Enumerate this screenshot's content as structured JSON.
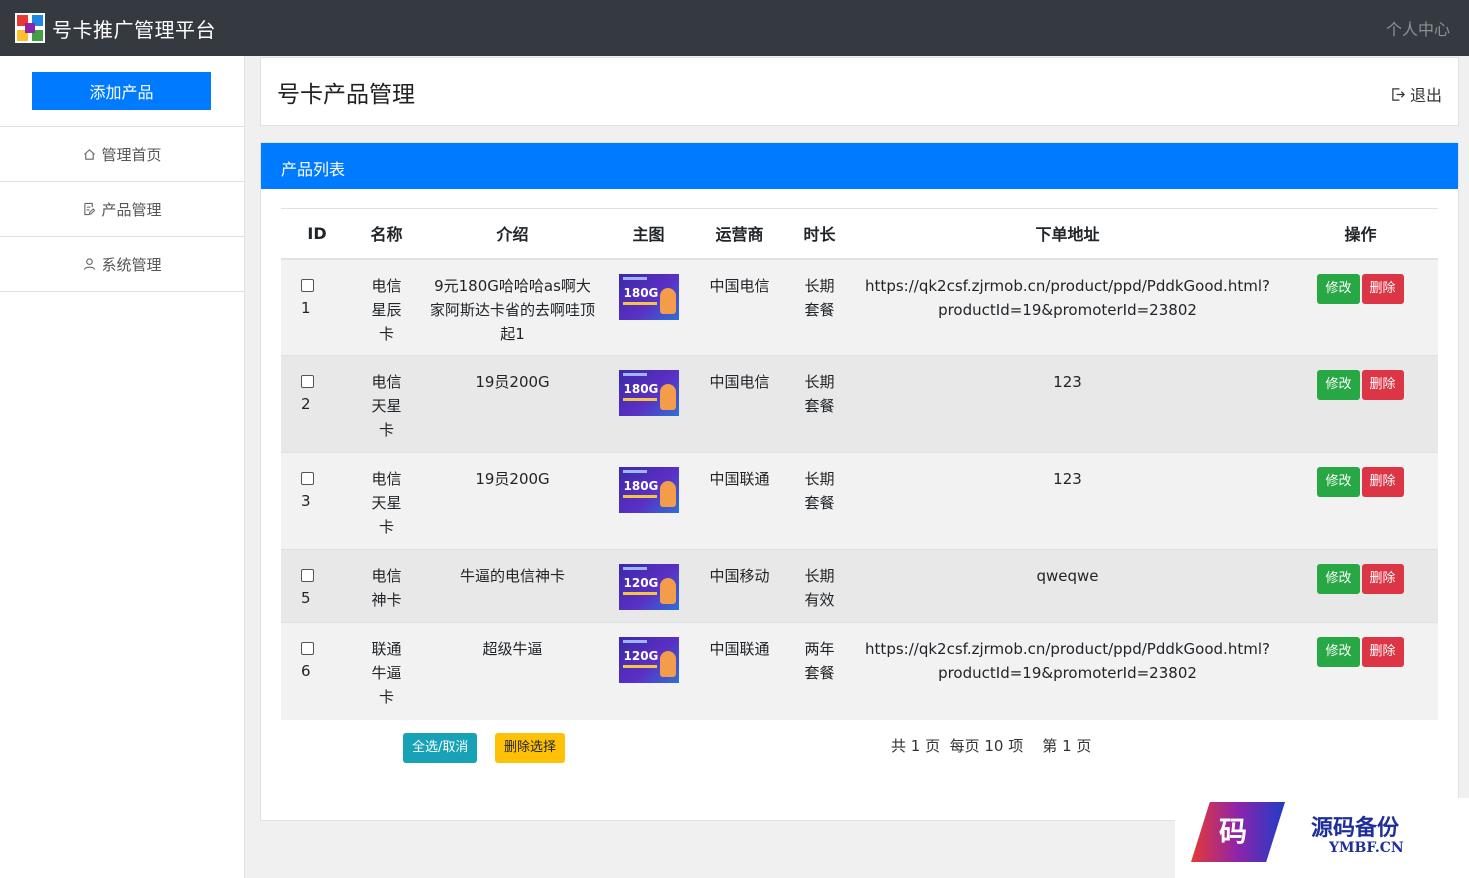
{
  "app": {
    "title": "号卡推广管理平台",
    "personal_center": "个人中心"
  },
  "sidebar": {
    "add_product": "添加产品",
    "items": [
      {
        "label": "管理首页",
        "icon": "home-icon"
      },
      {
        "label": "产品管理",
        "icon": "document-icon"
      },
      {
        "label": "系统管理",
        "icon": "user-icon"
      }
    ]
  },
  "header": {
    "title": "号卡产品管理",
    "logout": "退出"
  },
  "list": {
    "title": "产品列表",
    "columns": [
      "ID",
      "名称",
      "介绍",
      "主图",
      "运营商",
      "时长",
      "下单地址",
      "操作"
    ],
    "rows": [
      {
        "id": "1",
        "name": "电信星辰卡",
        "intro": "9元180G哈哈哈as啊大家阿斯达卡省的去啊哇顶起1",
        "thumb": "180G",
        "carrier": "中国电信",
        "duration": "长期套餐",
        "url": "https://qk2csf.zjrmob.cn/product/ppd/PddkGood.html?productId=19&promoterId=23802"
      },
      {
        "id": "2",
        "name": "电信天星卡",
        "intro": "19员200G",
        "thumb": "180G",
        "carrier": "中国电信",
        "duration": "长期套餐",
        "url": "123"
      },
      {
        "id": "3",
        "name": "电信天星卡",
        "intro": "19员200G",
        "thumb": "180G",
        "carrier": "中国联通",
        "duration": "长期套餐",
        "url": "123"
      },
      {
        "id": "5",
        "name": "电信神卡",
        "intro": "牛逼的电信神卡",
        "thumb": "120G",
        "carrier": "中国移动",
        "duration": "长期有效",
        "url": "qweqwe"
      },
      {
        "id": "6",
        "name": "联通牛逼卡",
        "intro": "超级牛逼",
        "thumb": "120G",
        "carrier": "中国联通",
        "duration": "两年套餐",
        "url": "https://qk2csf.zjrmob.cn/product/ppd/PddkGood.html?productId=19&promoterId=23802"
      }
    ],
    "edit_label": "修改",
    "delete_label": "删除",
    "select_all": "全选/取消",
    "delete_selected": "删除选择",
    "pager": "共 1 页  每页 10 项    第 1 页"
  },
  "watermark": {
    "char": "码",
    "name": "源码备份",
    "url": "YMBF.CN"
  },
  "colors": {
    "topbar": "#343a40",
    "primary": "#007bff",
    "success": "#28a745",
    "danger": "#dc3545",
    "info": "#17a2b8",
    "warning": "#ffc107"
  }
}
